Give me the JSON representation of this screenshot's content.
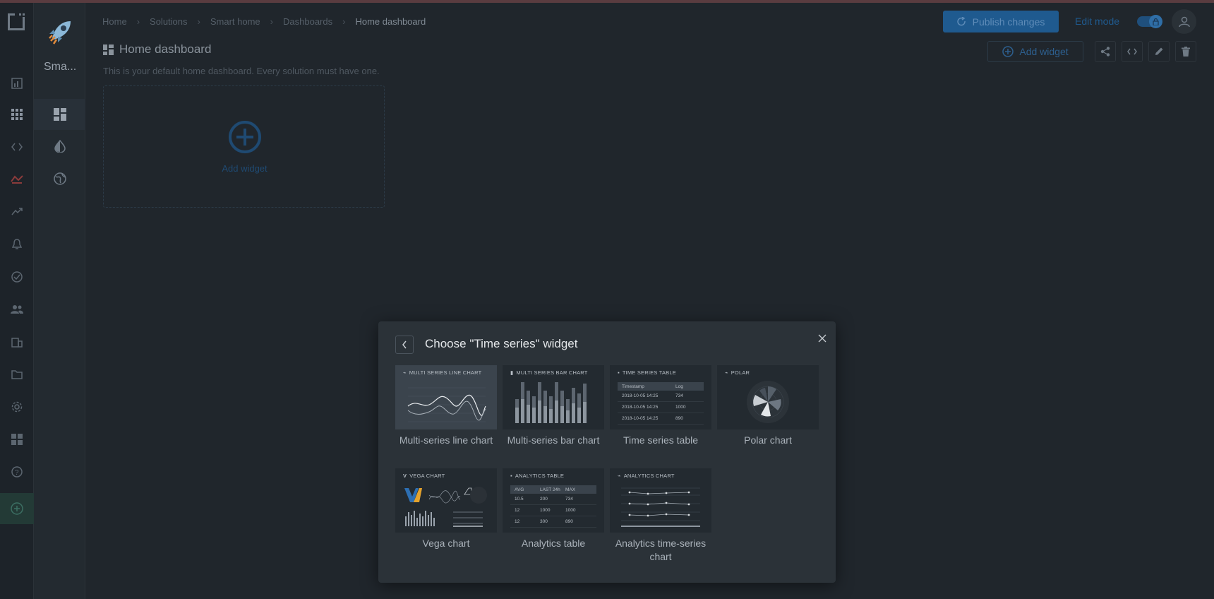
{
  "breadcrumbs": [
    "Home",
    "Solutions",
    "Smart home",
    "Dashboards",
    "Home dashboard"
  ],
  "solution": {
    "name": "Sma..."
  },
  "header": {
    "publish_label": "Publish changes",
    "edit_mode_label": "Edit mode"
  },
  "dashboard": {
    "title": "Home dashboard",
    "description": "This is your default home dashboard. Every solution must have one.",
    "add_widget_button": "Add widget",
    "placeholder_label": "Add widget"
  },
  "modal": {
    "title": "Choose \"Time series\" widget",
    "widgets": [
      {
        "thumb_title": "MULTI SERIES LINE CHART",
        "name": "Multi-series line chart",
        "selected": true
      },
      {
        "thumb_title": "MULTI SERIES BAR CHART",
        "name": "Multi-series bar chart"
      },
      {
        "thumb_title": "TIME SERIES TABLE",
        "name": "Time series table",
        "table": {
          "headers": [
            "Timestamp",
            "Log"
          ],
          "rows": [
            [
              "2018-10-05 14:25",
              "734"
            ],
            [
              "2018-10-05 14:25",
              "1000"
            ],
            [
              "2018-10-05 14:25",
              "890"
            ]
          ]
        }
      },
      {
        "thumb_title": "POLAR",
        "name": "Polar chart"
      },
      {
        "thumb_title": "VEGA CHART",
        "name": "Vega chart"
      },
      {
        "thumb_title": "ANALYTICS TABLE",
        "name": "Analytics table",
        "table": {
          "headers": [
            "AVG",
            "LAST 24h",
            "MAX"
          ],
          "rows": [
            [
              "10.5",
              "200",
              "734"
            ],
            [
              "12",
              "1000",
              "1000"
            ],
            [
              "12",
              "300",
              "890"
            ]
          ]
        }
      },
      {
        "thumb_title": "ANALYTICS CHART",
        "name": "Analytics time-series chart"
      }
    ]
  },
  "colors": {
    "accent": "#1f5a8f",
    "modal_bg": "#2b3238",
    "page_bg": "#20262c"
  }
}
